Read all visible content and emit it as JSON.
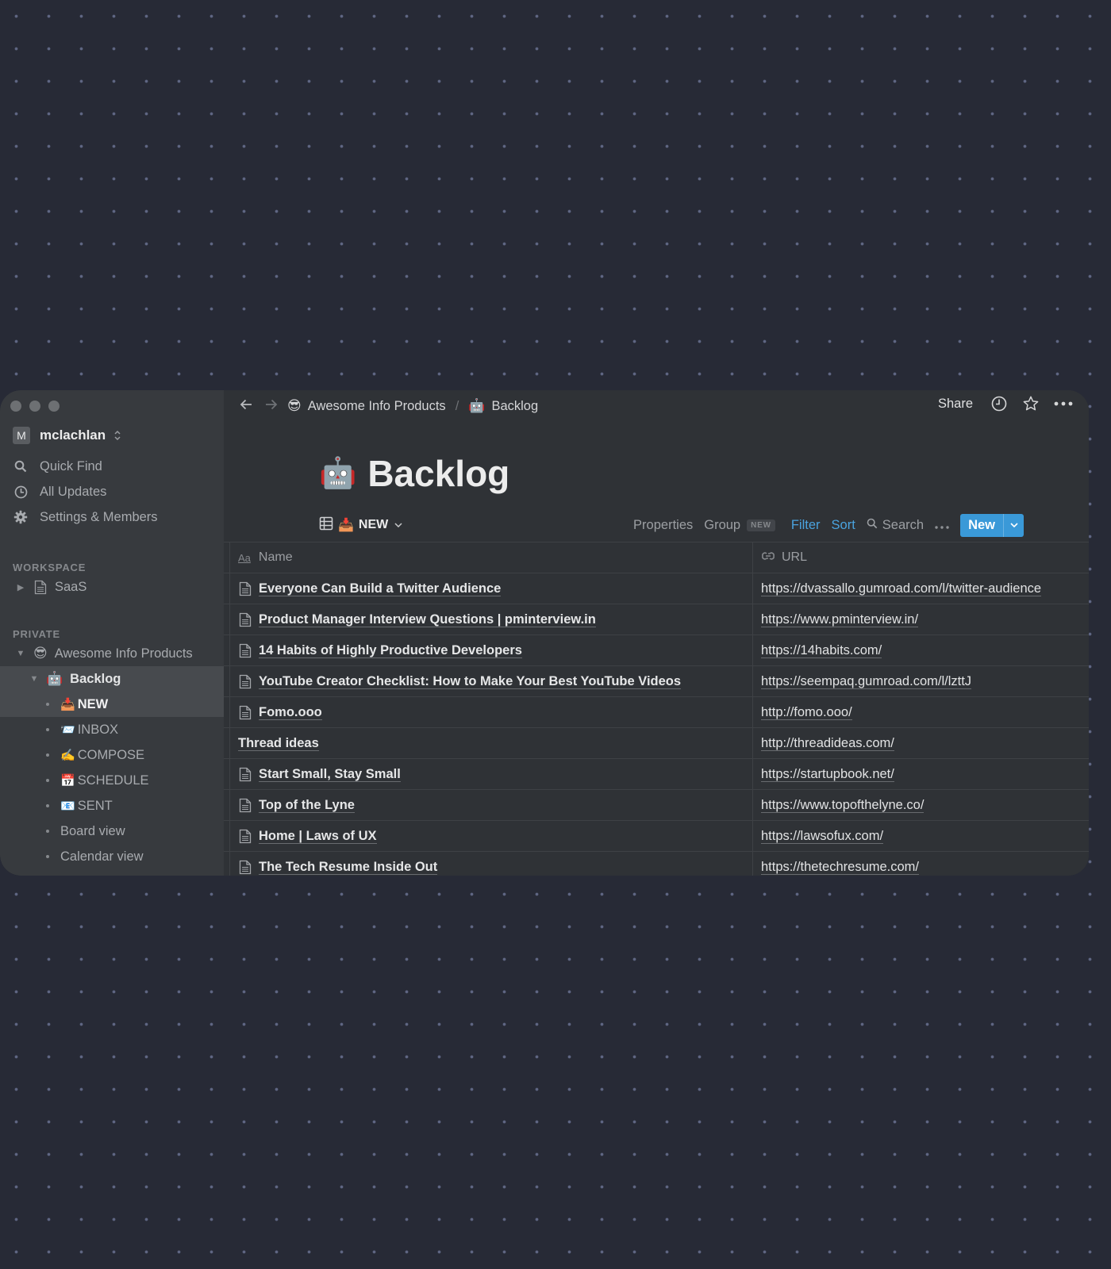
{
  "window": {
    "traffic_lights": [
      "close",
      "minimize",
      "zoom"
    ]
  },
  "sidebar": {
    "workspace": {
      "avatar_letter": "M",
      "name": "mclachlan"
    },
    "nav": [
      {
        "icon": "search-icon",
        "label": "Quick Find"
      },
      {
        "icon": "clock-icon",
        "label": "All Updates"
      },
      {
        "icon": "gear-icon",
        "label": "Settings & Members"
      }
    ],
    "workspace_section": {
      "label": "WORKSPACE",
      "items": [
        {
          "label": "SaaS",
          "icon": "page-icon",
          "expanded": false
        }
      ]
    },
    "private_section": {
      "label": "PRIVATE",
      "items": [
        {
          "label": "Awesome Info Products",
          "emoji": "😎",
          "expanded": true,
          "level": 0
        },
        {
          "label": "Backlog",
          "emoji": "🤖",
          "expanded": true,
          "level": 1
        },
        {
          "label": "NEW",
          "emoji": "📥",
          "level": 2,
          "selected": true
        },
        {
          "label": "INBOX",
          "emoji": "📨",
          "level": 2
        },
        {
          "label": "COMPOSE",
          "emoji": "✍️",
          "level": 2
        },
        {
          "label": "SCHEDULE",
          "emoji": "📅",
          "level": 2
        },
        {
          "label": "SENT",
          "emoji": "📧",
          "level": 2
        },
        {
          "label": "Board view",
          "emoji": "",
          "level": 2
        },
        {
          "label": "Calendar view",
          "emoji": "",
          "level": 2
        }
      ]
    }
  },
  "topbar": {
    "breadcrumb": [
      {
        "emoji": "😎",
        "label": "Awesome Info Products"
      },
      {
        "emoji": "🤖",
        "label": "Backlog"
      }
    ],
    "separator": "/",
    "share_label": "Share"
  },
  "page": {
    "emoji": "🤖",
    "title": "Backlog"
  },
  "view_bar": {
    "view_emoji": "📥",
    "view_name": "NEW",
    "properties": "Properties",
    "group": "Group",
    "group_badge": "NEW",
    "filter": "Filter",
    "sort": "Sort",
    "search": "Search",
    "new_button": "New"
  },
  "table": {
    "columns": [
      {
        "icon": "Aa",
        "label": "Name"
      },
      {
        "icon": "link-icon",
        "label": "URL"
      }
    ],
    "rows": [
      {
        "name": "Everyone Can Build a Twitter Audience",
        "url": "https://dvassallo.gumroad.com/l/twitter-audience",
        "has_icon": true
      },
      {
        "name": "Product Manager Interview Questions | pminterview.in",
        "url": "https://www.pminterview.in/",
        "has_icon": true
      },
      {
        "name": "14 Habits of Highly Productive Developers",
        "url": "https://14habits.com/",
        "has_icon": true
      },
      {
        "name": "YouTube Creator Checklist: How to Make Your Best YouTube Videos",
        "url": "https://seempaq.gumroad.com/l/lzttJ",
        "has_icon": true
      },
      {
        "name": "Fomo.ooo",
        "url": "http://fomo.ooo/",
        "has_icon": true
      },
      {
        "name": "Thread ideas",
        "url": "http://threadideas.com/",
        "has_icon": false
      },
      {
        "name": "Start Small, Stay Small",
        "url": "https://startupbook.net/",
        "has_icon": true
      },
      {
        "name": "Top of the Lyne",
        "url": "https://www.topofthelyne.co/",
        "has_icon": true
      },
      {
        "name": "Home | Laws of UX",
        "url": "https://lawsofux.com/",
        "has_icon": true
      },
      {
        "name": "The Tech Resume Inside Out",
        "url": "https://thetechresume.com/",
        "has_icon": true
      }
    ]
  },
  "colors": {
    "accent_blue": "#3a99d8",
    "link_blue": "#4aa3df",
    "sidebar_bg": "#373a3e",
    "main_bg": "#2f3236",
    "desktop_bg": "#272a36"
  }
}
